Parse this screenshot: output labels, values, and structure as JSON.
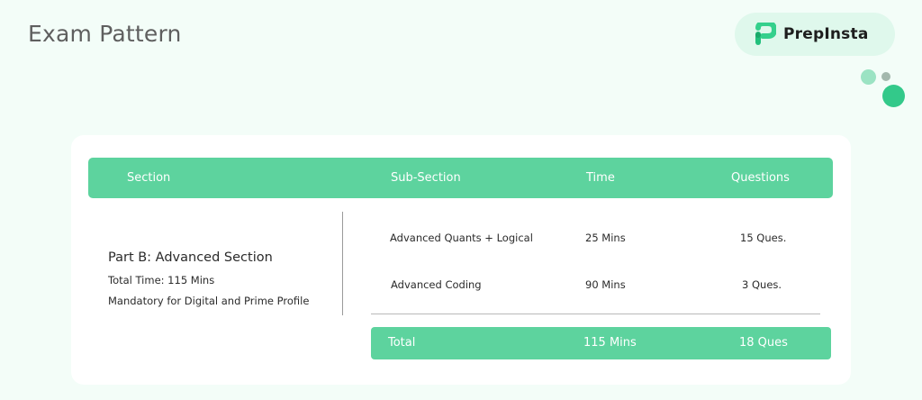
{
  "page": {
    "title": "Exam Pattern"
  },
  "logo": {
    "text": "PrepInsta",
    "icon": "prepinsta-logo-icon"
  },
  "colors": {
    "background": "#f3fdf8",
    "accent": "#5dd39e",
    "logo_pill": "#dff8ec",
    "deco_light": "#9be3c3",
    "deco_grey": "#a3b8ad",
    "deco_dark": "#33c98a"
  },
  "table": {
    "headers": {
      "section": "Section",
      "sub_section": "Sub-Section",
      "time": "Time",
      "questions": "Questions"
    },
    "section": {
      "name": "Part B: Advanced Section",
      "total_time": "Total Time: 115 Mins",
      "note": "Mandatory for Digital and Prime Profile"
    },
    "rows": [
      {
        "sub_section": "Advanced Quants + Logical",
        "time": "25 Mins",
        "questions": "15 Ques."
      },
      {
        "sub_section": "Advanced Coding",
        "time": "90 Mins",
        "questions": "3 Ques."
      }
    ],
    "total": {
      "label": "Total",
      "time": "115 Mins",
      "questions": "18 Ques"
    }
  }
}
